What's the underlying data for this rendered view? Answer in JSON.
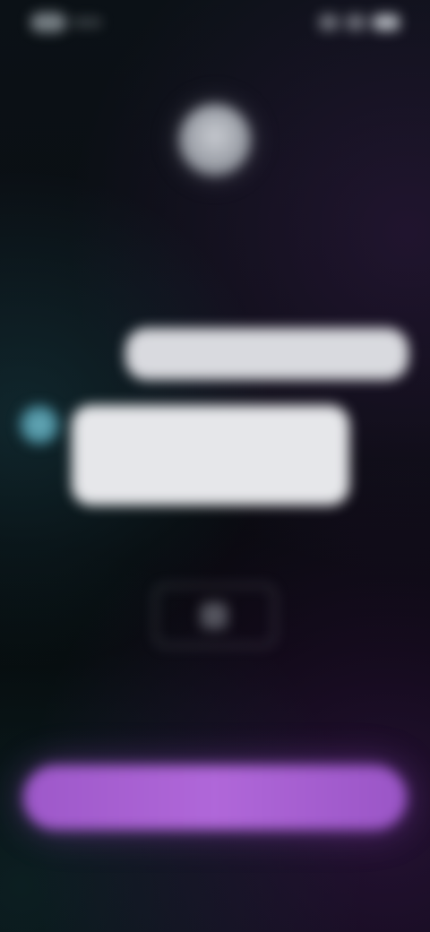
{
  "colors": {
    "background": "#05080b",
    "bubble_outgoing": "#d9dadf",
    "bubble_incoming": "#e6e7ea",
    "accent_purple": "#a85fd3",
    "bot_teal": "#4f97a6"
  },
  "status_bar": {
    "icons": [
      "time-pill",
      "signal-icon",
      "wifi-icon",
      "battery-icon"
    ]
  },
  "profile": {
    "avatar_icon": "avatar-circle",
    "name": "",
    "subtitle": ""
  },
  "chat": {
    "outgoing_message": "",
    "incoming_message": "",
    "bot_avatar_icon": "bot-avatar"
  },
  "media": {
    "caption": "",
    "icon": "image-icon",
    "label": ""
  },
  "footer": {
    "hint": "",
    "cta_label": "",
    "link": ""
  }
}
